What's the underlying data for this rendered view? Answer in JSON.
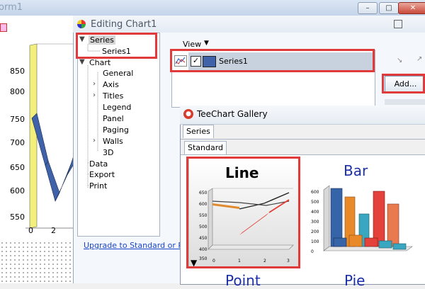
{
  "background_form": {
    "title": "orm1",
    "y_axis_labels": [
      "850",
      "800",
      "750",
      "700",
      "650",
      "600",
      "550"
    ],
    "x_axis_labels": [
      "0",
      "2"
    ],
    "window_buttons": [
      "minimize",
      "maximize",
      "close"
    ]
  },
  "dialog": {
    "title": "Editing Chart1",
    "tree": {
      "series_root": "Series",
      "series_child": "Series1",
      "chart_root": "Chart",
      "chart_children": [
        "General",
        "Axis",
        "Titles",
        "Legend",
        "Panel",
        "Paging",
        "Walls",
        "3D"
      ],
      "data": "Data",
      "export": "Export",
      "print": "Print"
    },
    "view_label": "View",
    "series_list_item": "Series1",
    "add_button": "Add...",
    "upgrade_link": "Upgrade to Standard or Pro v"
  },
  "gallery": {
    "title": "TeeChart Gallery",
    "outer_tab": "Series",
    "inner_tab": "Standard",
    "items": [
      "Line",
      "Bar",
      "Point",
      "Pie"
    ],
    "line_thumb_y_ticks": [
      "650",
      "600",
      "550",
      "500",
      "450",
      "400",
      "350"
    ],
    "line_thumb_x_ticks": [
      "0",
      "1",
      "2",
      "3"
    ],
    "bar_thumb_y_ticks": [
      "600",
      "500",
      "400",
      "300",
      "200",
      "100",
      "0"
    ]
  },
  "colors": {
    "highlight": "#e03a3a",
    "bar_series": "#3f62a8",
    "yellow_wall": "#f2ef7a"
  }
}
